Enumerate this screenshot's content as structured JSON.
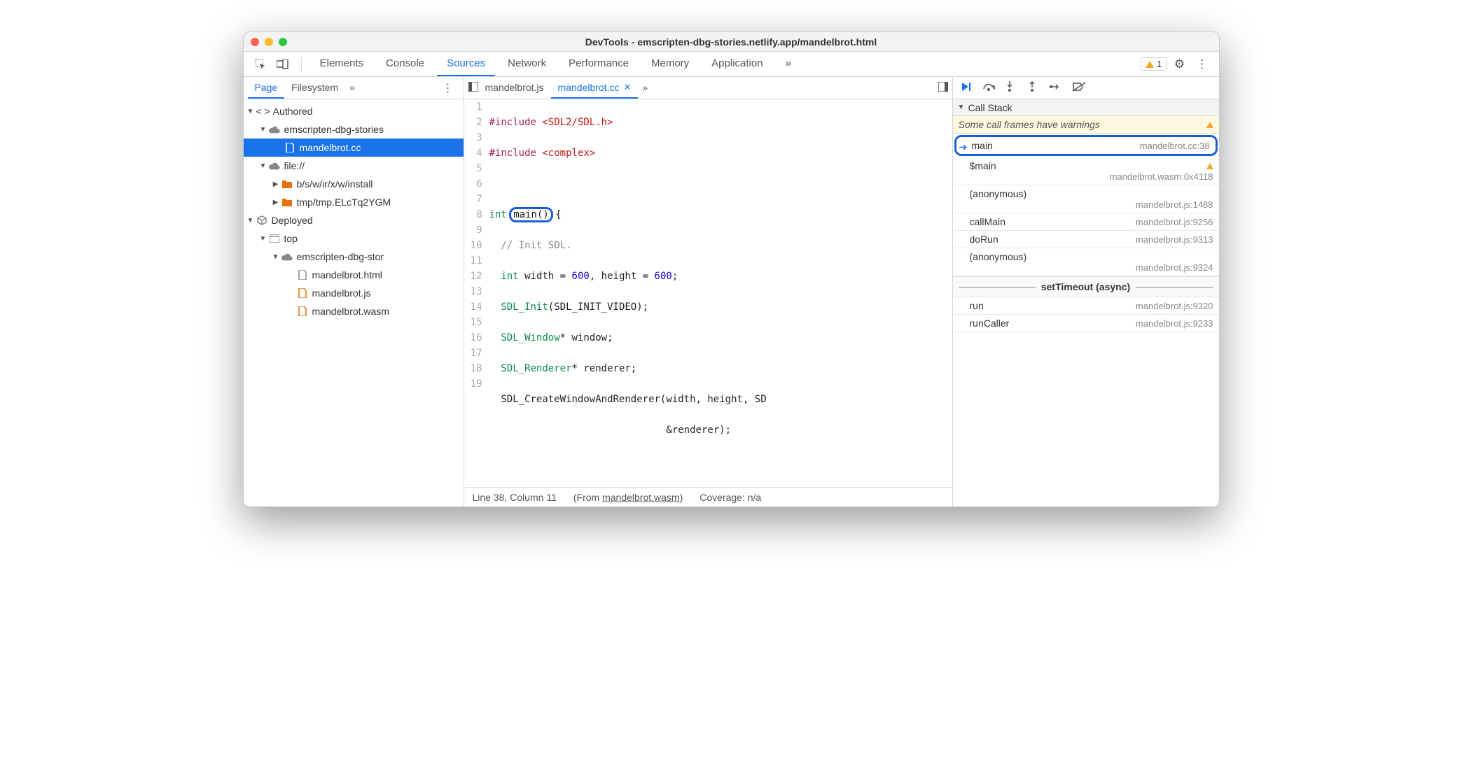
{
  "window": {
    "title": "DevTools - emscripten-dbg-stories.netlify.app/mandelbrot.html"
  },
  "tabs": {
    "items": [
      "Elements",
      "Console",
      "Sources",
      "Network",
      "Performance",
      "Memory",
      "Application"
    ],
    "active": "Sources",
    "overflow": "»",
    "warning_count": "1"
  },
  "navigator": {
    "tabs": [
      "Page",
      "Filesystem"
    ],
    "active": "Page",
    "overflow": "»",
    "tree": {
      "authored": "Authored",
      "cloud_origin": "emscripten-dbg-stories",
      "selected_file": "mandelbrot.cc",
      "file_origin": "file://",
      "folder1": "b/s/w/ir/x/w/install",
      "folder2": "tmp/tmp.ELcTq2YGM",
      "deployed": "Deployed",
      "top": "top",
      "cloud2": "emscripten-dbg-stor",
      "html": "mandelbrot.html",
      "js": "mandelbrot.js",
      "wasm": "mandelbrot.wasm"
    }
  },
  "editor": {
    "open_tabs": [
      {
        "name": "mandelbrot.js",
        "active": false
      },
      {
        "name": "mandelbrot.cc",
        "active": true
      }
    ],
    "overflow": "»",
    "status": {
      "line": "Line 38, Column 11",
      "from_pre": "(From ",
      "from_link": "mandelbrot.wasm",
      "from_post": ")",
      "coverage": "Coverage: n/a"
    }
  },
  "debugger": {
    "callstack_label": "Call Stack",
    "warning": "Some call frames have warnings",
    "frames": [
      {
        "name": "main",
        "loc": "mandelbrot.cc:38",
        "current": true
      },
      {
        "name": "$main",
        "loc": "mandelbrot.wasm:0x4118",
        "warn": true
      },
      {
        "name": "(anonymous)",
        "loc": "mandelbrot.js:1488"
      },
      {
        "name": "callMain",
        "loc": "mandelbrot.js:9256"
      },
      {
        "name": "doRun",
        "loc": "mandelbrot.js:9313"
      },
      {
        "name": "(anonymous)",
        "loc": "mandelbrot.js:9324"
      }
    ],
    "async_label": "setTimeout (async)",
    "async_frames": [
      {
        "name": "run",
        "loc": "mandelbrot.js:9320"
      },
      {
        "name": "runCaller",
        "loc": "mandelbrot.js:9233"
      }
    ]
  }
}
